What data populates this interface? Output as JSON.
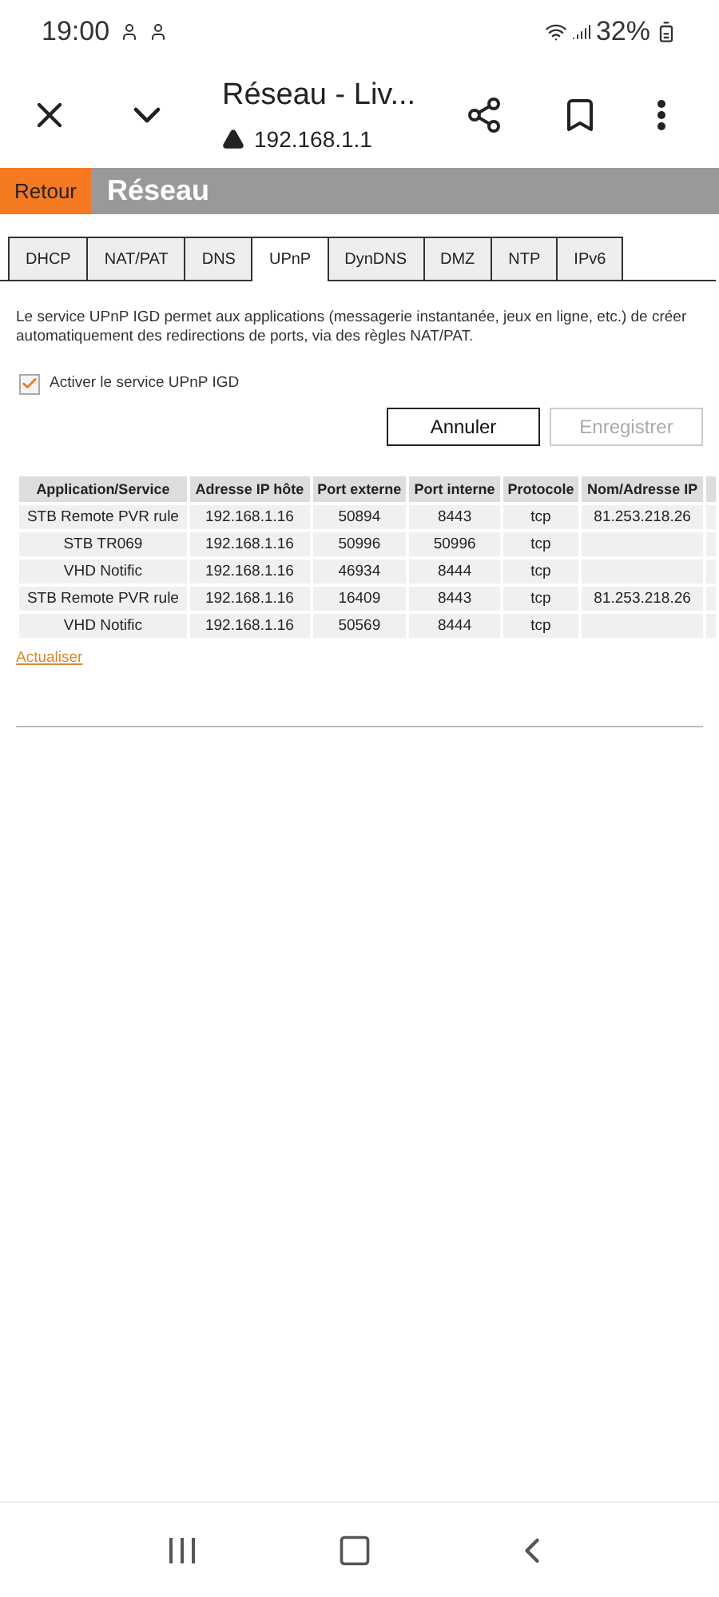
{
  "status_bar": {
    "time": "19:00",
    "battery": "32%"
  },
  "browser": {
    "title": "Réseau - Liv...",
    "url": "192.168.1.1"
  },
  "header": {
    "back": "Retour",
    "title": "Réseau"
  },
  "tabs": [
    {
      "label": "DHCP",
      "selected": false
    },
    {
      "label": "NAT/PAT",
      "selected": false
    },
    {
      "label": "DNS",
      "selected": false
    },
    {
      "label": "UPnP",
      "selected": true
    },
    {
      "label": "DynDNS",
      "selected": false
    },
    {
      "label": "DMZ",
      "selected": false
    },
    {
      "label": "NTP",
      "selected": false
    },
    {
      "label": "IPv6",
      "selected": false
    }
  ],
  "description": "Le service UPnP IGD permet aux applications (messagerie instantanée, jeux en ligne, etc.) de créer automatiquement des redirections de ports, via des règles NAT/PAT.",
  "enable_checkbox": {
    "label": "Activer le service UPnP IGD",
    "checked": true
  },
  "buttons": [
    {
      "label": "Annuler",
      "disabled": false
    },
    {
      "label": "Enregistrer",
      "disabled": true
    }
  ],
  "table": {
    "columns": [
      "Application/Service",
      "Adresse IP hôte",
      "Port externe",
      "Port interne",
      "Protocole",
      "Nom/Adresse IP"
    ],
    "rows": [
      [
        "STB Remote PVR rule",
        "192.168.1.16",
        "50894",
        "8443",
        "tcp",
        "81.253.218.26"
      ],
      [
        "STB TR069",
        "192.168.1.16",
        "50996",
        "50996",
        "tcp",
        ""
      ],
      [
        "VHD Notific",
        "192.168.1.16",
        "46934",
        "8444",
        "tcp",
        ""
      ],
      [
        "STB Remote PVR rule",
        "192.168.1.16",
        "16409",
        "8443",
        "tcp",
        "81.253.218.26"
      ],
      [
        "VHD Notific",
        "192.168.1.16",
        "50569",
        "8444",
        "tcp",
        ""
      ]
    ]
  },
  "refresh_link": "Actualiser"
}
